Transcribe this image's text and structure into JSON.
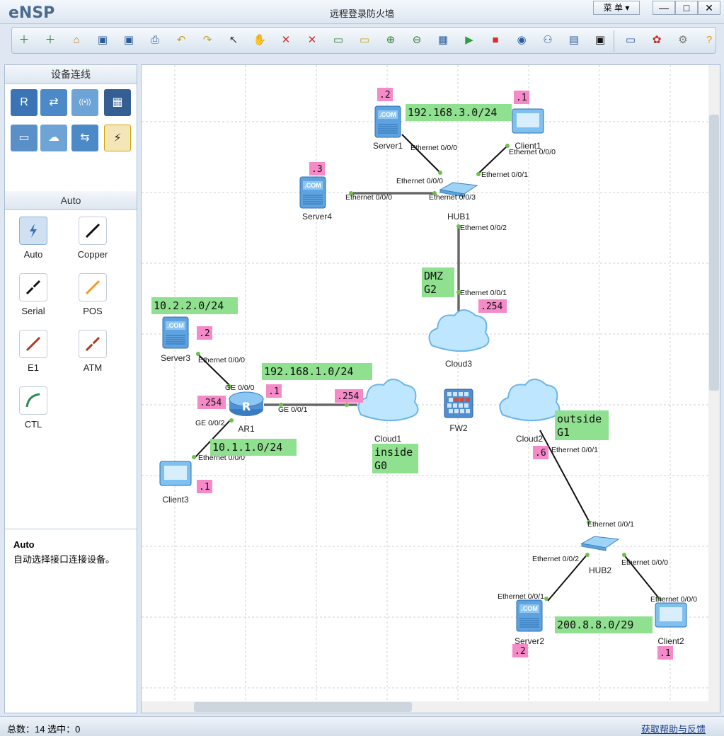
{
  "app": {
    "logo": "eNSP",
    "title": "远程登录防火墙",
    "menu_label": "菜 单"
  },
  "window_controls": {
    "minimize": "—",
    "maximize": "□",
    "close": "✕"
  },
  "toolbar": {
    "icons": [
      "new-topology-icon",
      "new-example-icon",
      "open-icon",
      "save-icon",
      "save-as-icon",
      "print-icon",
      "undo-icon",
      "redo-icon",
      "select-icon",
      "pan-hand-icon",
      "delete-icon",
      "delete-links-icon",
      "text-annotation-icon",
      "rectangle-icon",
      "zoom-in-icon",
      "zoom-out-icon",
      "fit-view-icon",
      "start-device-icon",
      "stop-device-icon",
      "capture-icon",
      "topology-icon",
      "grid-icon",
      "terminal-icon",
      "forum-icon",
      "huawei-icon",
      "settings-icon",
      "help-icon"
    ]
  },
  "left_panel": {
    "device_header": "设备连线",
    "device_icons": [
      "router-icon",
      "switch-icon",
      "wlan-icon",
      "firewall-icon",
      "pc-icon",
      "cloud-icon",
      "other-device-icon",
      "link-icon"
    ],
    "link_header": "Auto",
    "link_types": [
      {
        "label": "Auto",
        "color": "#3b6ea5"
      },
      {
        "label": "Copper",
        "color": "#111111"
      },
      {
        "label": "Serial",
        "color": "#111111"
      },
      {
        "label": "POS",
        "color": "#f29a2e"
      },
      {
        "label": "E1",
        "color": "#b0391c"
      },
      {
        "label": "ATM",
        "color": "#b0391c"
      },
      {
        "label": "CTL",
        "color": "#2e8b57"
      }
    ],
    "help": {
      "title": "Auto",
      "text": "自动选择接口连接设备。"
    }
  },
  "topology": {
    "devices": [
      {
        "id": "server1",
        "label": "Server1",
        "kind": "server"
      },
      {
        "id": "client1",
        "label": "Client1",
        "kind": "client"
      },
      {
        "id": "server4",
        "label": "Server4",
        "kind": "server"
      },
      {
        "id": "hub1",
        "label": "HUB1",
        "kind": "hub"
      },
      {
        "id": "cloud3",
        "label": "Cloud3",
        "kind": "cloud"
      },
      {
        "id": "server3",
        "label": "Server3",
        "kind": "server"
      },
      {
        "id": "ar1",
        "label": "AR1",
        "kind": "router"
      },
      {
        "id": "client3",
        "label": "Client3",
        "kind": "client"
      },
      {
        "id": "cloud1",
        "label": "Cloud1",
        "kind": "cloud"
      },
      {
        "id": "fw2",
        "label": "FW2",
        "kind": "firewall"
      },
      {
        "id": "cloud2",
        "label": "Cloud2",
        "kind": "cloud"
      },
      {
        "id": "hub2",
        "label": "HUB2",
        "kind": "hub"
      },
      {
        "id": "server2",
        "label": "Server2",
        "kind": "server"
      },
      {
        "id": "client2",
        "label": "Client2",
        "kind": "client"
      }
    ],
    "port_labels": [
      "Ethernet 0/0/0",
      "Ethernet 0/0/0",
      "Ethernet 0/0/1",
      "Ethernet 0/0/0",
      "Ethernet 0/0/3",
      "Ethernet 0/0/0",
      "Ethernet 0/0/2",
      "Ethernet 0/0/1",
      "Ethernet 0/0/0",
      "GE 0/0/0",
      "GE 0/0/1",
      "GE 0/0/2",
      "Ethernet 0/0/1",
      "Ethernet 0/0/0",
      "Ethernet 0/0/1",
      "Ethernet 0/0/2",
      "Ethernet 0/0/0",
      "Ethernet 0/0/1",
      "Ethernet 0/0/0",
      "Ethernet 0/0/0"
    ],
    "green_notes": [
      "192.168.3.0/24",
      "DMZ\nG2",
      "10.2.2.0/24",
      "192.168.1.0/24",
      "10.1.1.0/24",
      "inside\nG0",
      "outside\nG1",
      "200.8.8.0/29"
    ],
    "pink_notes": [
      ".2",
      ".1",
      ".3",
      ".254",
      ".2",
      ".1",
      ".254",
      ".254",
      ".1",
      ".6",
      ".2",
      ".1"
    ]
  },
  "statusbar": {
    "total": "总数：14 选中：0",
    "help_link": "获取帮助与反馈"
  }
}
